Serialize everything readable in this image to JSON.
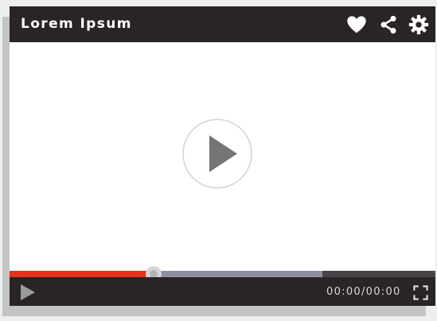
{
  "player": {
    "title": "Lorem Ipsum",
    "time_display": "00:00/00:00",
    "progress": {
      "played_fraction": 0.339,
      "buffered_fraction": 0.734
    }
  },
  "icons": {
    "favorite": "heart-icon",
    "share": "share-icon",
    "settings": "gear-icon",
    "center_play": "play-icon",
    "control_play": "play-icon",
    "fullscreen": "fullscreen-icon"
  },
  "colors": {
    "bar_background": "#2a2428",
    "played": "#e8321c",
    "buffered": "#8b8f9e",
    "track": "#4a4448",
    "icon": "#ffffff",
    "time_text": "#d8d8d8"
  }
}
